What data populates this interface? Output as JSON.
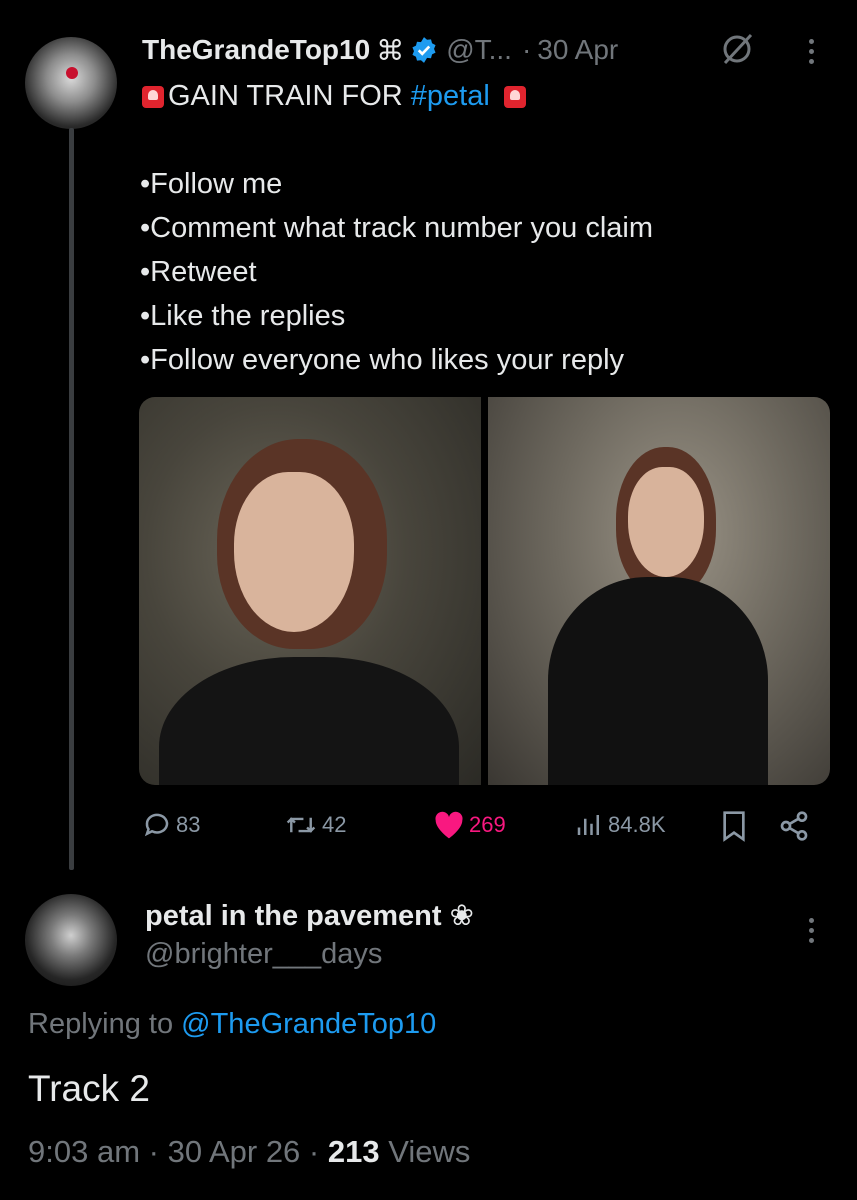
{
  "tweet": {
    "author_name": "TheGrandeTop10",
    "author_symbol": "⌘",
    "handle": "@T...",
    "separator": "·",
    "date": "30 Apr",
    "headline_prefix": "GAIN TRAIN FOR ",
    "hashtag": "#petal",
    "bullets": [
      "•Follow me",
      "•Comment what track number you claim",
      "•Retweet",
      "•Like the replies",
      "•Follow everyone who likes your reply"
    ],
    "stats": {
      "replies": "83",
      "retweets": "42",
      "likes": "269",
      "views": "84.8K"
    }
  },
  "reply": {
    "author_name": "petal in the pavement",
    "author_symbol": "❀",
    "handle": "@brighter___days",
    "replying_label": "Replying to ",
    "replying_handle": "@TheGrandeTop10",
    "text": "Track 2",
    "time": "9:03 am",
    "date": "30 Apr 26",
    "views_count": "213",
    "views_label": " Views",
    "sep": " · "
  },
  "colors": {
    "background": "#000000",
    "accent": "#1d9bf0",
    "like": "#f91880",
    "muted": "#71767b",
    "verified": "#1d9bf0"
  },
  "icons": [
    "verified-badge-icon",
    "mute-icon",
    "more-icon",
    "siren-icon",
    "reply-icon",
    "retweet-icon",
    "heart-icon",
    "views-icon",
    "bookmark-icon",
    "share-icon"
  ]
}
